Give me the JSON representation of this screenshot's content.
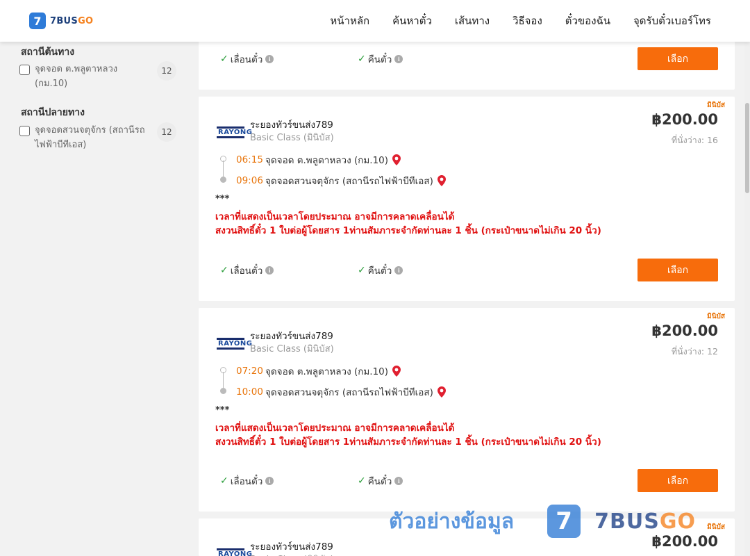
{
  "header": {
    "logo_mark": "7",
    "logo_text_main": "7BUS",
    "logo_text_accent": "GO",
    "nav": [
      "หน้าหลัก",
      "ค้นหาตั๋ว",
      "เส้นทาง",
      "วิธีจอง",
      "ตั๋วของฉัน",
      "จุดรับตั๋วเบอร์โทร"
    ]
  },
  "filters": {
    "origin": {
      "title": "สถานีต้นทาง",
      "options": [
        {
          "label": "จุดจอด ต.พลูตาหลวง (กม.10)",
          "count": "12",
          "checked": false
        }
      ]
    },
    "destination": {
      "title": "สถานีปลายทาง",
      "options": [
        {
          "label": "จุดจอดสวนจตุจักร (สถานีรถไฟฟ้าบีทีเอส)",
          "count": "12",
          "checked": false
        }
      ]
    }
  },
  "labels": {
    "reschedule": "เลื่อนตั๋ว",
    "refund": "คืนตั๋ว",
    "select": "เลือก",
    "info": "i",
    "check": "✓"
  },
  "trips": [
    {
      "vehicle_type": "มินิบัส",
      "operator_logo": "RAYONG",
      "operator": "ระยองทัวร์ขนส่ง789",
      "bus_class": "Basic Class (มินิบัส)",
      "price": "฿200.00",
      "seats": "ที่นั่งว่าง: 16",
      "depart_time": "06:15",
      "depart_stop": "จุดจอด ต.พลูตาหลวง (กม.10)",
      "arrive_time": "09:06",
      "arrive_stop": "จุดจอดสวนจตุจักร (สถานีรถไฟฟ้าบีทีเอส)",
      "stars": "***",
      "notice_1": "เวลาที่แสดงเป็นเวลาโดยประมาณ อาจมีการคลาดเคลื่อนได้",
      "notice_2": "สงวนสิทธิ์ตั๋ว 1 ใบต่อผู้โดยสาร 1ท่านสัมภาระจำกัดท่านละ 1 ชิ้น (กระเป๋าขนาดไม่เกิน 20 นิ้ว)"
    },
    {
      "vehicle_type": "มินิบัส",
      "operator_logo": "RAYONG",
      "operator": "ระยองทัวร์ขนส่ง789",
      "bus_class": "Basic Class (มินิบัส)",
      "price": "฿200.00",
      "seats": "ที่นั่งว่าง: 12",
      "depart_time": "07:20",
      "depart_stop": "จุดจอด ต.พลูตาหลวง (กม.10)",
      "arrive_time": "10:00",
      "arrive_stop": "จุดจอดสวนจตุจักร (สถานีรถไฟฟ้าบีทีเอส)",
      "stars": "***",
      "notice_1": "เวลาที่แสดงเป็นเวลาโดยประมาณ อาจมีการคลาดเคลื่อนได้",
      "notice_2": "สงวนสิทธิ์ตั๋ว 1 ใบต่อผู้โดยสาร 1ท่านสัมภาระจำกัดท่านละ 1 ชิ้น (กระเป๋าขนาดไม่เกิน 20 นิ้ว)"
    },
    {
      "vehicle_type": "มินิบัส",
      "operator_logo": "RAYONG",
      "operator": "ระยองทัวร์ขนส่ง789",
      "bus_class": "Basic Class (มินิบัส)",
      "price": "฿200.00"
    }
  ],
  "watermark": {
    "thai": "ตัวอย่างข้อมูล",
    "mark": "7",
    "brand_main": "7BUS",
    "brand_accent": "GO"
  },
  "colors": {
    "accent_orange": "#f76c0c",
    "time_orange": "#e8740a",
    "notice_red": "#e01010",
    "brand_blue": "#2e7bd8"
  }
}
